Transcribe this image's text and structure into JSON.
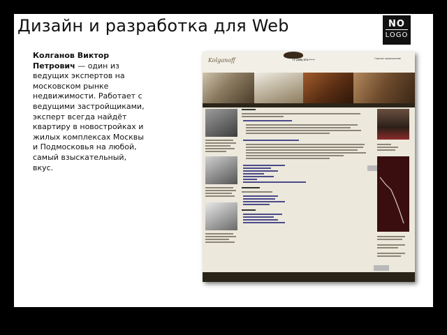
{
  "slide": {
    "title": "Дизайн и разработка для Web",
    "logo": {
      "line1": "NO",
      "line2": "LOGO"
    },
    "description": {
      "name": "Колганов Виктор Петрович",
      "text": " — один из ведущих экспертов на московском рынке недвижимости. Работает с ведущими застройщиками, эксперт всегда найдёт квартиру в новостройках и жилых комплексах Москвы и Подмосковья на любой, самый взыскательный, вкус."
    }
  },
  "website": {
    "brand": "Kolganoff",
    "phone": "+7 (495) 971-**-**",
    "callback": "Горячее предложение"
  }
}
